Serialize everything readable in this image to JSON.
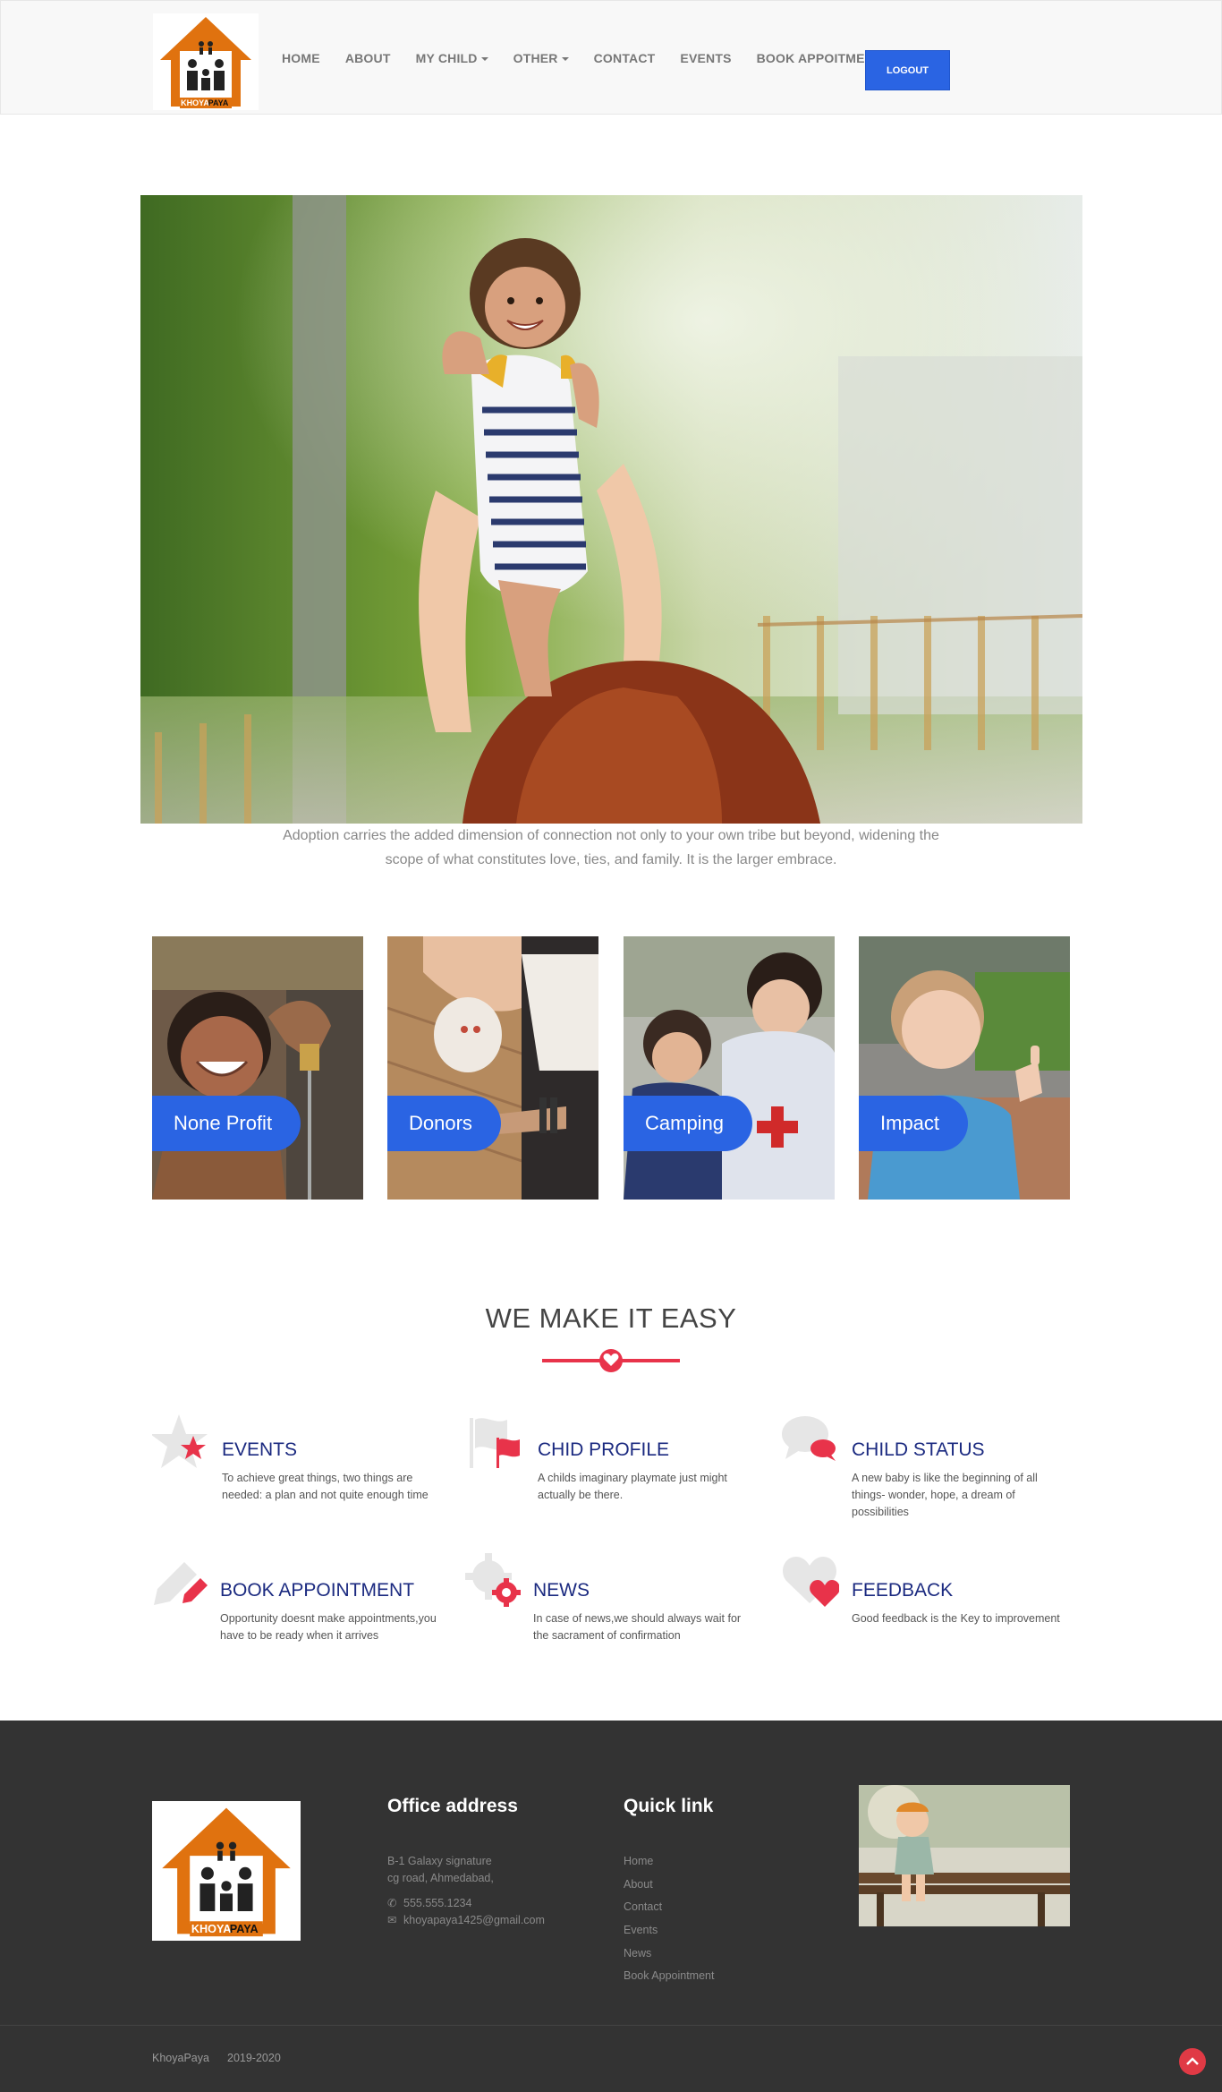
{
  "nav": {
    "logo_text_a": "KHOYA",
    "logo_text_b": "PAYA",
    "items": [
      {
        "label": "HOME"
      },
      {
        "label": "ABOUT"
      },
      {
        "label": "MY CHILD",
        "dropdown": true
      },
      {
        "label": "OTHER",
        "dropdown": true
      },
      {
        "label": "CONTACT"
      },
      {
        "label": "EVENTS"
      },
      {
        "label": "BOOK APPOITMENT"
      }
    ],
    "logout_label": "LOGOUT"
  },
  "hero": {
    "caption": "Adoption carries the added dimension of connection not only to your own tribe but beyond, widening the scope of what constitutes love, ties, and family. It is the larger embrace."
  },
  "cards": [
    {
      "label": "None Profit"
    },
    {
      "label": "Donors"
    },
    {
      "label": "Camping"
    },
    {
      "label": "Impact"
    }
  ],
  "section": {
    "title": "WE MAKE IT EASY"
  },
  "features": [
    {
      "title": "EVENTS",
      "text": "To achieve great things, two things are needed: a plan and not quite enough time",
      "icon": "star-icon"
    },
    {
      "title": "CHID PROFILE",
      "text": "A childs imaginary playmate just might actually be there.",
      "icon": "flag-icon"
    },
    {
      "title": "CHILD STATUS",
      "text": "A new baby is like the beginning of all things- wonder, hope, a dream of possibilities",
      "icon": "chat-icon"
    },
    {
      "title": "BOOK APPOINTMENT",
      "text": "Opportunity doesnt make appointments,you have to be ready when it arrives",
      "icon": "pencil-icon"
    },
    {
      "title": "NEWS",
      "text": "In case of news,we should always wait for the sacrament of confirmation",
      "icon": "gear-icon"
    },
    {
      "title": "FEEDBACK",
      "text": "Good feedback is the Key to improvement",
      "icon": "heart-icon"
    }
  ],
  "footer": {
    "office_heading": "Office address",
    "address_line1": "B-1 Galaxy signature",
    "address_line2": "cg road, Ahmedabad,",
    "phone": "555.555.1234",
    "email": "khoyapaya1425@gmail.com",
    "quick_heading": "Quick link",
    "quick_links": [
      "Home",
      "About",
      "Contact",
      "Events",
      "News",
      "Book Appointment"
    ],
    "brand": "KhoyaPaya",
    "years": "2019-2020"
  },
  "colors": {
    "accent_blue": "#2a64e3",
    "accent_red": "#e8334a",
    "title_navy": "#1b2a80",
    "footer_bg": "#333333",
    "logo_orange": "#e0720f"
  }
}
